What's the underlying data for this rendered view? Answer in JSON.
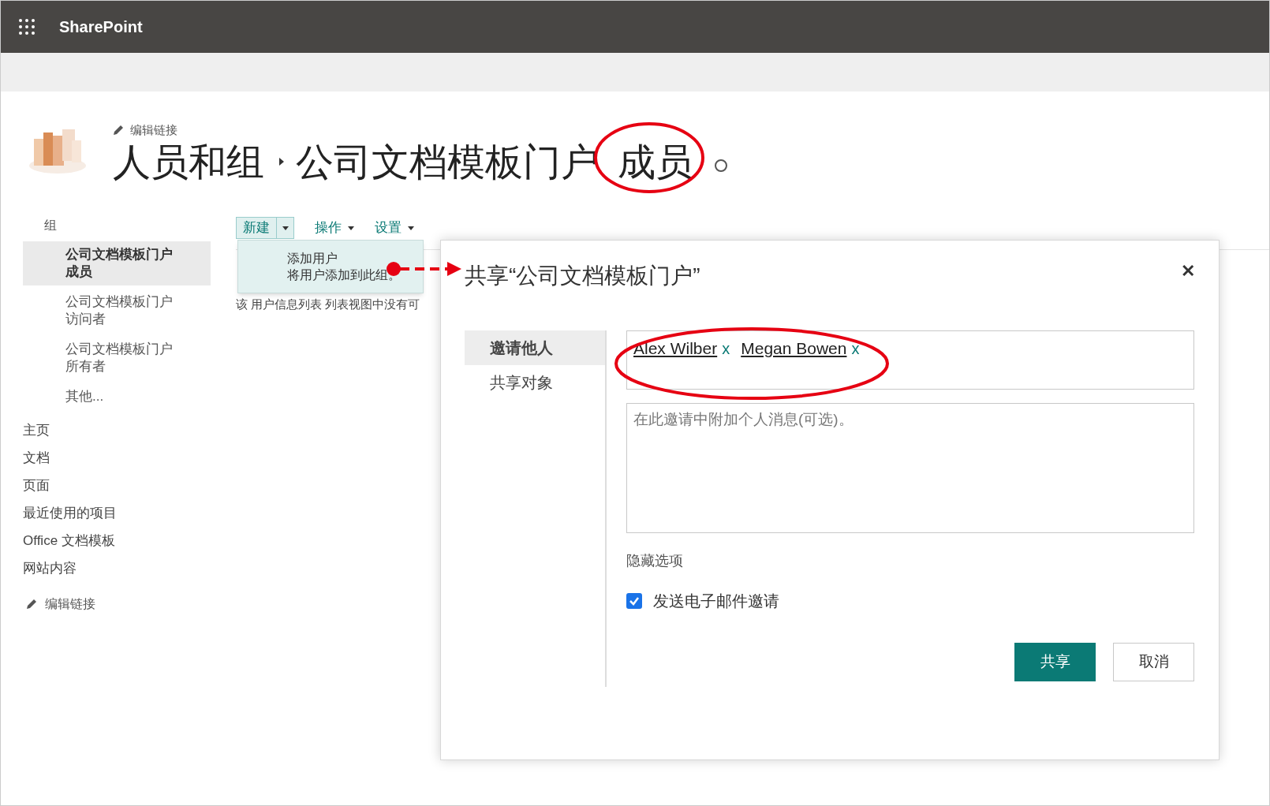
{
  "suite_bar": {
    "title": "SharePoint"
  },
  "header": {
    "edit_link": "编辑链接",
    "breadcrumb": [
      "人员和组",
      "公司文档模板门户"
    ],
    "circled_title_part": "成员"
  },
  "nav": {
    "groups_heading": "组",
    "groups": [
      {
        "label": "公司文档模板门户成员",
        "selected": true
      },
      {
        "label": "公司文档模板门户访问者",
        "selected": false
      },
      {
        "label": "公司文档模板门户所有者",
        "selected": false
      },
      {
        "label": "其他...",
        "selected": false
      }
    ],
    "links": [
      "主页",
      "文档",
      "页面",
      "最近使用的项目",
      "Office 文档模板",
      "网站内容"
    ],
    "edit_link": "编辑链接"
  },
  "toolbar": [
    {
      "label": "新建",
      "kind": "split",
      "expanded": true
    },
    {
      "label": "操作",
      "kind": "menu",
      "expanded": false
    },
    {
      "label": "设置",
      "kind": "menu",
      "expanded": false
    }
  ],
  "dropdown": {
    "title": "添加用户",
    "description": "将用户添加到此组。"
  },
  "list_message": "该 用户信息列表 列表视图中没有可",
  "dialog": {
    "title": "共享“公司文档模板门户”",
    "close": "✕",
    "tabs": [
      {
        "label": "邀请他人",
        "selected": true
      },
      {
        "label": "共享对象",
        "selected": false
      }
    ],
    "people": [
      {
        "name": "Alex Wilber",
        "remove": "x"
      },
      {
        "name": "Megan Bowen",
        "remove": "x"
      }
    ],
    "message_placeholder": "在此邀请中附加个人消息(可选)。",
    "hide_options": "隐藏选项",
    "send_email": {
      "label": "发送电子邮件邀请",
      "checked": true
    },
    "buttons": [
      {
        "label": "共享",
        "kind": "primary"
      },
      {
        "label": "取消",
        "kind": "secondary"
      }
    ]
  }
}
